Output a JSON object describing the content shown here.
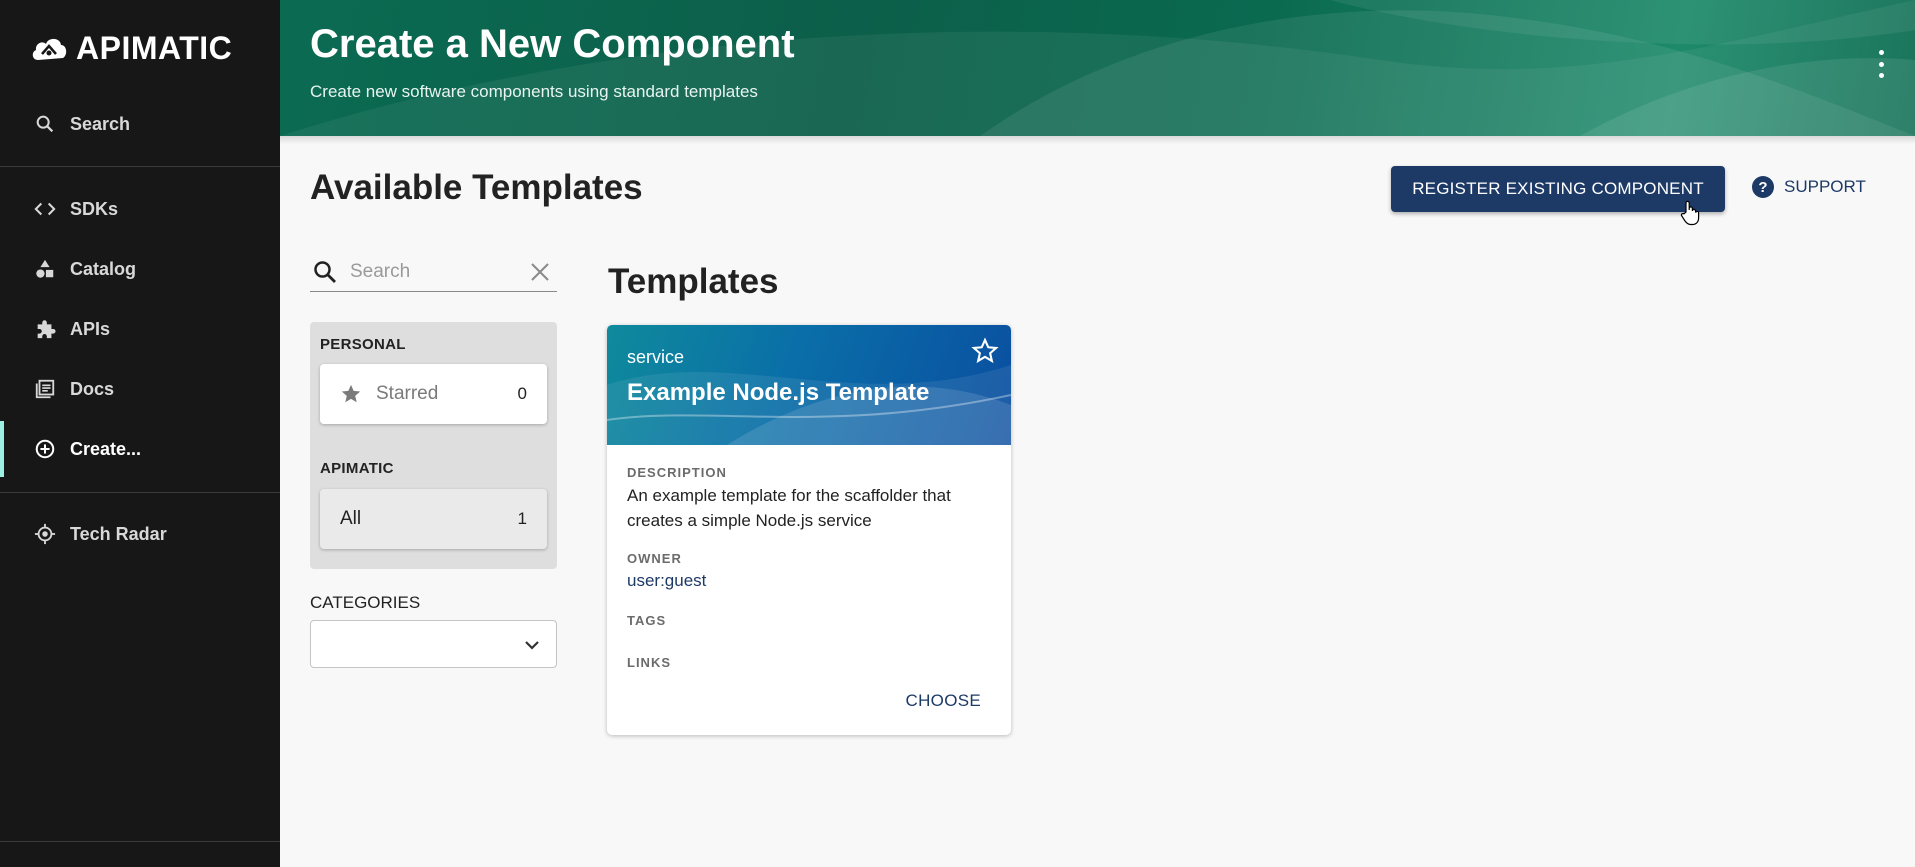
{
  "sidebar": {
    "logo_text": "APIMATIC",
    "search_label": "Search",
    "items": [
      {
        "label": "SDKs",
        "icon": "code-icon"
      },
      {
        "label": "Catalog",
        "icon": "catalog-icon"
      },
      {
        "label": "APIs",
        "icon": "puzzle-icon"
      },
      {
        "label": "Docs",
        "icon": "docs-icon"
      },
      {
        "label": "Create...",
        "icon": "add-circle-icon",
        "active": true
      }
    ],
    "tech_radar_label": "Tech Radar",
    "accent_color": "#9bf0e1"
  },
  "header": {
    "title": "Create a New Component",
    "subtitle": "Create new software components using standard templates"
  },
  "content": {
    "title": "Available Templates",
    "register_label": "REGISTER EXISTING COMPONENT",
    "support_label": "SUPPORT"
  },
  "filters": {
    "search_placeholder": "Search",
    "personal_label": "PERSONAL",
    "starred_label": "Starred",
    "starred_count": "0",
    "org_label": "APIMATIC",
    "all_label": "All",
    "all_count": "1",
    "categories_label": "CATEGORIES",
    "categories_value": ""
  },
  "templates": {
    "title": "Templates",
    "cards": [
      {
        "type": "service",
        "title": "Example Node.js Template",
        "description_label": "DESCRIPTION",
        "description": "An example template for the scaffolder that creates a simple Node.js service",
        "owner_label": "OWNER",
        "owner": "user:guest",
        "tags_label": "TAGS",
        "links_label": "LINKS",
        "choose_label": "CHOOSE"
      }
    ]
  },
  "colors": {
    "primary": "#1d3a66",
    "header_green": "#0b6b52",
    "sidebar_bg": "#171717"
  }
}
